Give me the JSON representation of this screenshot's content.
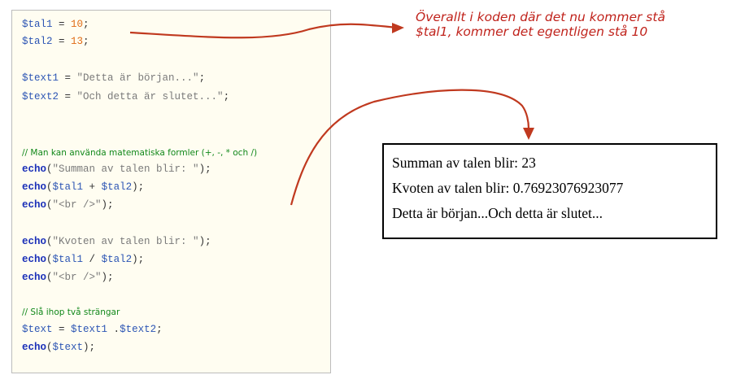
{
  "code": {
    "line1": {
      "var": "$tal1",
      "op": " = ",
      "num": "10",
      "end": ";"
    },
    "line2": {
      "var": "$tal2",
      "op": " = ",
      "num": "13",
      "end": ";"
    },
    "line3": {
      "var": "$text1",
      "op": " = ",
      "str": "\"Detta är början...\"",
      "end": ";"
    },
    "line4": {
      "var": "$text2",
      "op": " = ",
      "str": "\"Och detta är slutet...\"",
      "end": ";"
    },
    "comment1": "// Man kan använda matematiska formler (+, -, * och /)",
    "line5": {
      "kw": "echo",
      "open": "(",
      "str": "\"Summan av talen blir: \"",
      "close": ");"
    },
    "line6": {
      "kw": "echo",
      "open": "(",
      "a": "$tal1",
      "op": " + ",
      "b": "$tal2",
      "close": ");"
    },
    "line7": {
      "kw": "echo",
      "open": "(",
      "str": "\"<br />\"",
      "close": ");"
    },
    "line8": {
      "kw": "echo",
      "open": "(",
      "str": "\"Kvoten av talen blir: \"",
      "close": ");"
    },
    "line9": {
      "kw": "echo",
      "open": "(",
      "a": "$tal1",
      "op": " / ",
      "b": "$tal2",
      "close": ");"
    },
    "line10": {
      "kw": "echo",
      "open": "(",
      "str": "\"<br />\"",
      "close": ");"
    },
    "comment2": "// Slå ihop två strängar",
    "line11": {
      "var": "$text",
      "op": " = ",
      "a": "$text1",
      "mid": " .",
      "b": "$text2",
      "end": ";"
    },
    "line12": {
      "kw": "echo",
      "open": "(",
      "a": "$text",
      "close": ");"
    }
  },
  "annotation": {
    "line1": "Överallt i koden där det nu kommer stå",
    "line2": "$tal1, kommer det egentligen stå 10"
  },
  "output": {
    "line1": "Summan av talen blir: 23",
    "line2": "Kvoten av talen blir: 0.76923076923077",
    "line3": "Detta är början...Och detta är slutet..."
  },
  "colors": {
    "arrow": "#c0391f",
    "annotation_text": "#c0231c",
    "code_background": "#fffdf1",
    "variable": "#2c55b4",
    "number": "#e06c16",
    "string": "#7a7a7a",
    "keyword": "#1a2fb8",
    "comment": "#11881a"
  }
}
